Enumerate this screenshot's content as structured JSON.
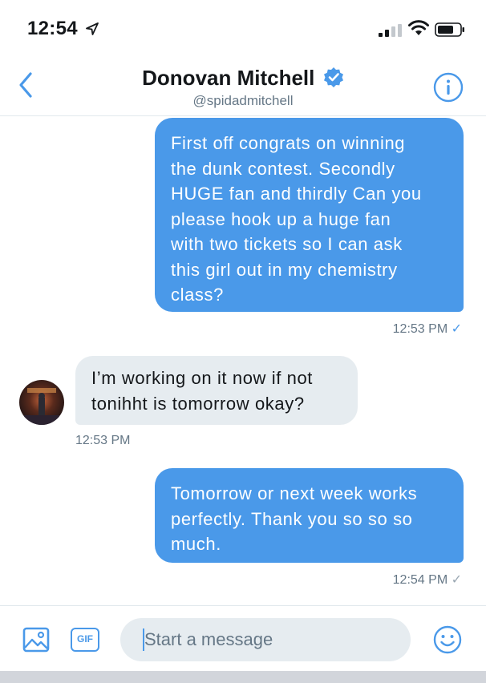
{
  "status_bar": {
    "time": "12:54"
  },
  "header": {
    "name": "Donovan Mitchell",
    "handle": "@spidadmitchell"
  },
  "messages": [
    {
      "direction": "sent",
      "lines": [
        "First off congrats on winning",
        "the dunk contest. Secondly",
        "HUGE fan and thirdly Can you",
        "please hook up a huge fan",
        "with two tickets so I can ask",
        "this girl out in my chemistry",
        "class?"
      ],
      "time": "12:53 PM",
      "check": "✓"
    },
    {
      "direction": "received",
      "lines": [
        "I’m working on it now if not",
        "tonihht is tomorrow okay?"
      ],
      "time": "12:53 PM"
    },
    {
      "direction": "sent",
      "lines": [
        "Tomorrow or next week works",
        "perfectly. Thank you so so so",
        "much."
      ],
      "time": "12:54 PM",
      "check": "✓"
    }
  ],
  "composer": {
    "gif_label": "GIF",
    "placeholder": "Start a message"
  },
  "colors": {
    "accent": "#4a99e9",
    "received_bubble": "#e6ecf0",
    "secondary_text": "#657786"
  }
}
